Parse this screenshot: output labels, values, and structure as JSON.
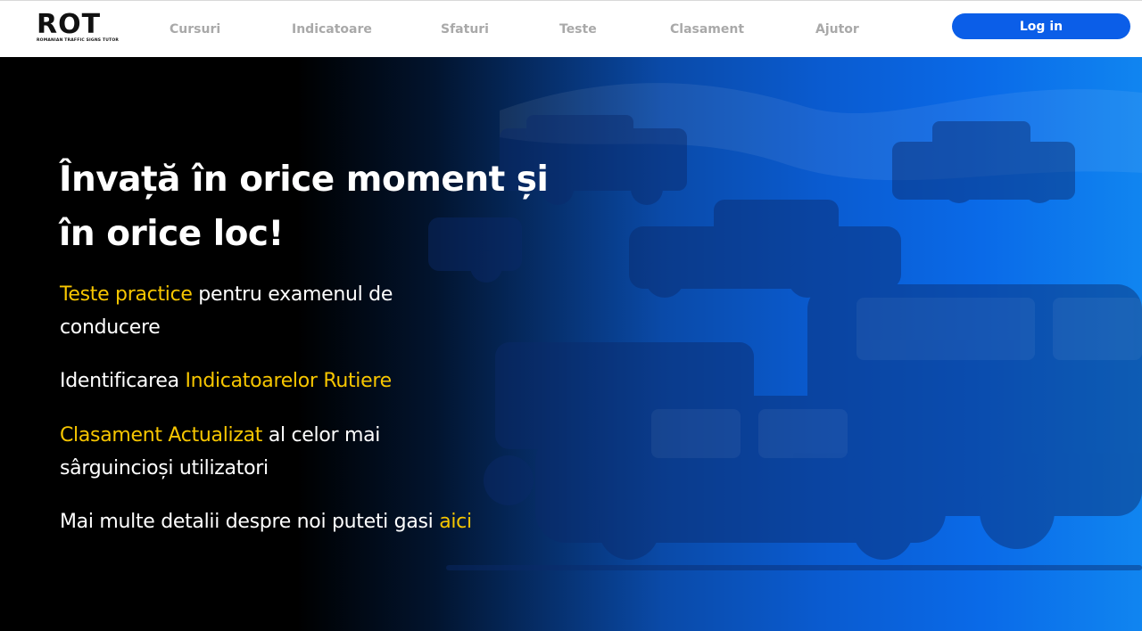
{
  "header": {
    "logo": {
      "title": "ROT",
      "subtitle": "ROMANIAN TRAFFIC SIGNS TUTOR"
    },
    "nav": [
      {
        "label": "Cursuri"
      },
      {
        "label": "Indicatoare"
      },
      {
        "label": "Sfaturi"
      },
      {
        "label": "Teste"
      },
      {
        "label": "Clasament"
      },
      {
        "label": "Ajutor"
      }
    ],
    "login_label": "Log in"
  },
  "hero": {
    "headline_line1": "Învață în orice moment și",
    "headline_line2": "în orice loc!",
    "features": [
      {
        "highlight": "Teste practice",
        "text": " pentru examenul de conducere"
      },
      {
        "text": "Identificarea ",
        "highlight": "Indicatoarelor Rutiere"
      },
      {
        "highlight": "Clasament Actualizat",
        "text": " al celor mai sârguincioși utilizatori"
      },
      {
        "text": "Mai multe detalii despre noi puteti gasi ",
        "link": "aici"
      }
    ]
  },
  "colors": {
    "accent": "#0b5ee8",
    "highlight": "#f7c600",
    "nav_text": "#a9a9a9"
  }
}
